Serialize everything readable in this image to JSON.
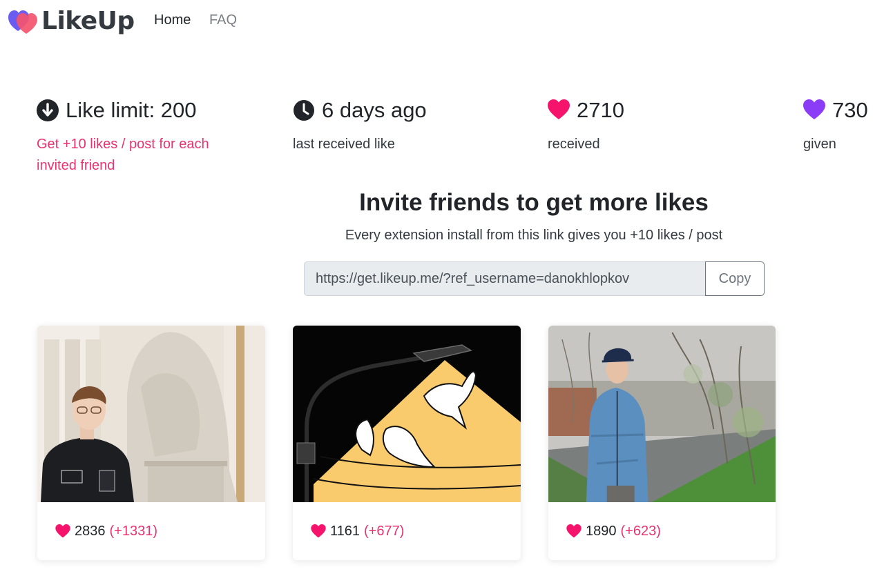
{
  "nav": {
    "brand": "LikeUp",
    "links": [
      {
        "label": "Home"
      },
      {
        "label": "FAQ"
      }
    ]
  },
  "stats": [
    {
      "icon": "arrow-down-circle-icon",
      "value": "Like limit: 200",
      "label": "Get +10 likes / post for each invited friend"
    },
    {
      "icon": "clock-icon",
      "value": "6 days ago",
      "label": "last received like"
    },
    {
      "icon": "heart-icon",
      "value": "2710",
      "label": "received",
      "color": "#f5136b"
    },
    {
      "icon": "heart-icon",
      "value": "730",
      "label": "given",
      "color": "#8b3cf7"
    }
  ],
  "invite": {
    "title": "Invite friends to get more likes",
    "subtitle": "Every extension install from this link gives you +10 likes / post",
    "link": "https://get.likeup.me/?ref_username=danokhlopkov",
    "copy_label": "Copy"
  },
  "posts": [
    {
      "likes": "2836",
      "delta": "(+1331)"
    },
    {
      "likes": "1161",
      "delta": "(+677)"
    },
    {
      "likes": "1890",
      "delta": "(+623)"
    }
  ],
  "colors": {
    "accent_pink": "#f5136b",
    "link_pink": "#e8336f",
    "accent_purple": "#8b3cf7",
    "text_dark": "#212529"
  }
}
